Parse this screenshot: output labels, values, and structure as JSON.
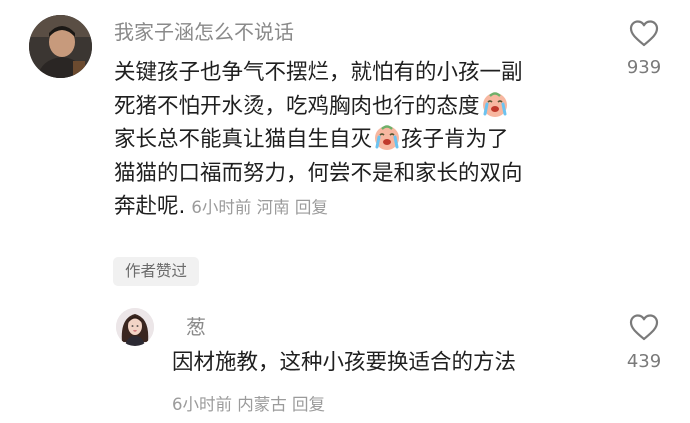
{
  "main_comment": {
    "username": "我家子涵怎么不说话",
    "lines": [
      "关键孩子也争气不摆烂，就怕有的小孩一副",
      "死猪不怕开水烫，吃鸡胸肉也行的态度",
      "家长总不能真让猫自生自灭",
      "孩子肯为了",
      "猫猫的口福而努力，何尝不是和家长的双向",
      "奔赴呢."
    ],
    "emoji_icon": "crying-face-emoji",
    "meta": "6小时前 河南 回复",
    "author_badge": "作者赞过",
    "like_count": "939"
  },
  "reply_comment": {
    "username": "葱",
    "text": "因材施教，这种小孩要换适合的方法",
    "meta": "6小时前 内蒙古 回复",
    "like_count": "439"
  },
  "icons": {
    "like": "heart-outline-icon",
    "emoji": "crying-face-emoji"
  },
  "colors": {
    "text": "#1f1f1f",
    "username": "#8a8a8a",
    "meta": "#9b9b9b",
    "badge_bg": "#f1f1f1",
    "icon": "#7a7a7a"
  }
}
